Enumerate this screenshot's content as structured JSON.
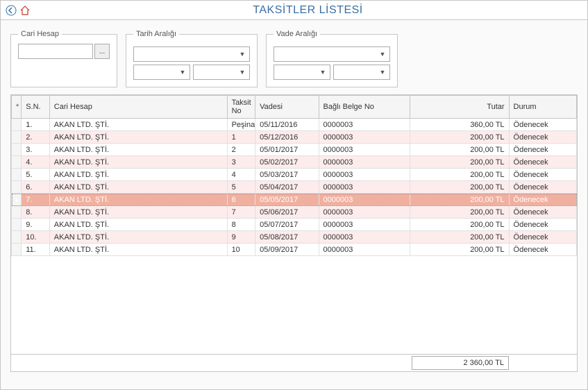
{
  "title": "TAKSİTLER LİSTESİ",
  "filters": {
    "cari_hesap": {
      "legend": "Cari Hesap",
      "value": "",
      "ellipsis": "..."
    },
    "tarih_araligi": {
      "legend": "Tarih Aralığı"
    },
    "vade_araligi": {
      "legend": "Vade Aralığı"
    }
  },
  "grid": {
    "columns": {
      "indicator": "*",
      "sn": "S.N.",
      "cari": "Cari Hesap",
      "taksit": "Taksit No",
      "vadesi": "Vadesi",
      "belge": "Bağlı Belge No",
      "tutar": "Tutar",
      "durum": "Durum"
    },
    "rows": [
      {
        "sn": "1.",
        "cari": "AKAN LTD. ŞTİ.",
        "taksit": "Peşinat",
        "vadesi": "05/11/2016",
        "belge": "0000003",
        "tutar": "360,00 TL",
        "durum": "Ödenecek"
      },
      {
        "sn": "2.",
        "cari": "AKAN LTD. ŞTİ.",
        "taksit": "1",
        "vadesi": "05/12/2016",
        "belge": "0000003",
        "tutar": "200,00 TL",
        "durum": "Ödenecek"
      },
      {
        "sn": "3.",
        "cari": "AKAN LTD. ŞTİ.",
        "taksit": "2",
        "vadesi": "05/01/2017",
        "belge": "0000003",
        "tutar": "200,00 TL",
        "durum": "Ödenecek"
      },
      {
        "sn": "4.",
        "cari": "AKAN LTD. ŞTİ.",
        "taksit": "3",
        "vadesi": "05/02/2017",
        "belge": "0000003",
        "tutar": "200,00 TL",
        "durum": "Ödenecek"
      },
      {
        "sn": "5.",
        "cari": "AKAN LTD. ŞTİ.",
        "taksit": "4",
        "vadesi": "05/03/2017",
        "belge": "0000003",
        "tutar": "200,00 TL",
        "durum": "Ödenecek"
      },
      {
        "sn": "6.",
        "cari": "AKAN LTD. ŞTİ.",
        "taksit": "5",
        "vadesi": "05/04/2017",
        "belge": "0000003",
        "tutar": "200,00 TL",
        "durum": "Ödenecek"
      },
      {
        "sn": "7.",
        "cari": "AKAN LTD. ŞTİ.",
        "taksit": "6",
        "vadesi": "05/05/2017",
        "belge": "0000003",
        "tutar": "200,00 TL",
        "durum": "Ödenecek"
      },
      {
        "sn": "8.",
        "cari": "AKAN LTD. ŞTİ.",
        "taksit": "7",
        "vadesi": "05/06/2017",
        "belge": "0000003",
        "tutar": "200,00 TL",
        "durum": "Ödenecek"
      },
      {
        "sn": "9.",
        "cari": "AKAN LTD. ŞTİ.",
        "taksit": "8",
        "vadesi": "05/07/2017",
        "belge": "0000003",
        "tutar": "200,00 TL",
        "durum": "Ödenecek"
      },
      {
        "sn": "10.",
        "cari": "AKAN LTD. ŞTİ.",
        "taksit": "9",
        "vadesi": "05/08/2017",
        "belge": "0000003",
        "tutar": "200,00 TL",
        "durum": "Ödenecek"
      },
      {
        "sn": "11.",
        "cari": "AKAN LTD. ŞTİ.",
        "taksit": "10",
        "vadesi": "05/09/2017",
        "belge": "0000003",
        "tutar": "200,00 TL",
        "durum": "Ödenecek"
      }
    ],
    "selected_index": 6,
    "footer_total": "2 360,00 TL"
  }
}
